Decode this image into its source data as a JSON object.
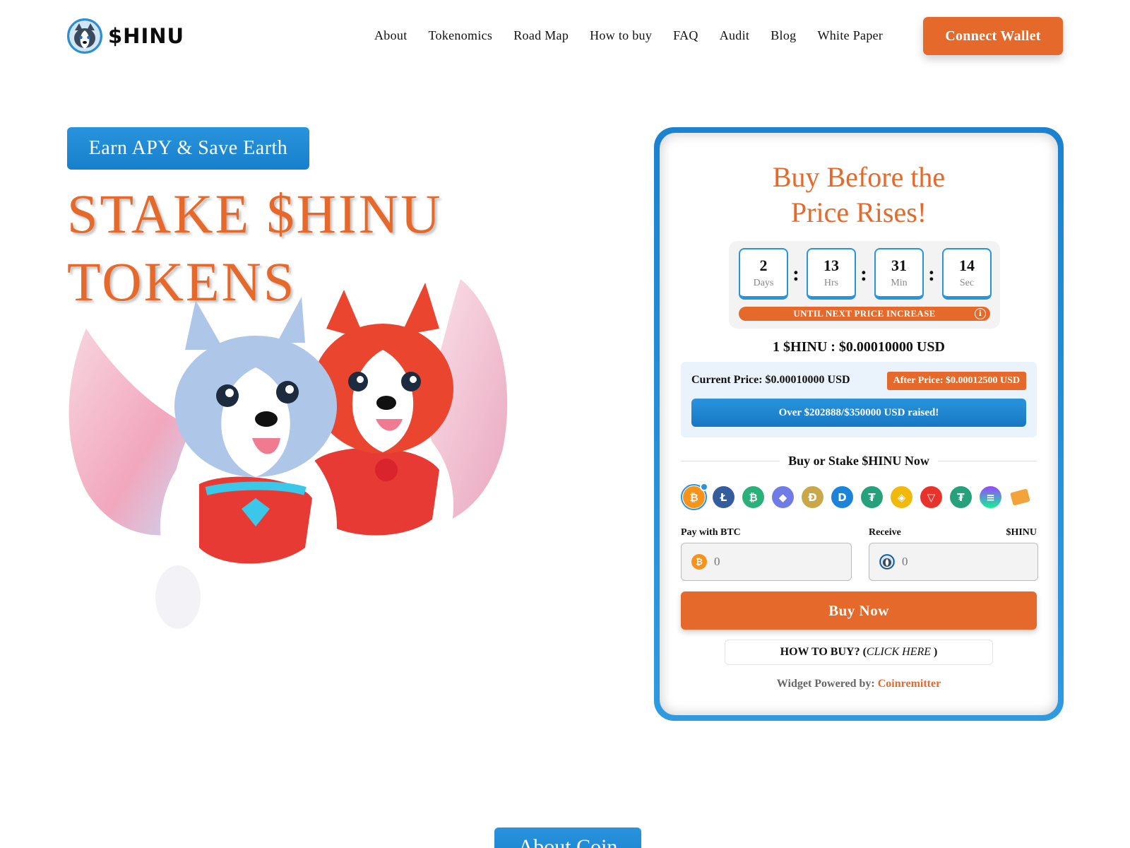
{
  "brand": {
    "name": "$HINU"
  },
  "nav": {
    "items": [
      "About",
      "Tokenomics",
      "Road Map",
      "How to buy",
      "FAQ",
      "Audit",
      "Blog",
      "White Paper"
    ],
    "connect_label": "Connect Wallet"
  },
  "hero": {
    "badge": "Earn APY & Save Earth",
    "title_line1": "STAKE $HINU",
    "title_line2": "TOKENS"
  },
  "widget": {
    "title_line1": "Buy Before the",
    "title_line2": "Price Rises!",
    "timer": [
      {
        "value": "2",
        "label": "Days"
      },
      {
        "value": "13",
        "label": "Hrs"
      },
      {
        "value": "31",
        "label": "Min"
      },
      {
        "value": "14",
        "label": "Sec"
      }
    ],
    "timer_caption": "UNTIL NEXT PRICE INCREASE",
    "rate": "1 $HINU : $0.00010000 USD",
    "current_price": "Current Price: $0.00010000 USD",
    "after_price": "After Price: $0.00012500 USD",
    "raised": "Over $202888/$350000 USD raised!",
    "buy_heading": "Buy or Stake $HINU Now",
    "coins": [
      "bitcoin-icon",
      "litecoin-icon",
      "bitcoin-cash-icon",
      "ethereum-icon",
      "dogecoin-icon",
      "dash-icon",
      "tether-icon",
      "bnb-icon",
      "tron-icon",
      "tether-trc20-icon",
      "solana-icon",
      "card-icon"
    ],
    "pay_label": "Pay with BTC",
    "receive_label": "Receive",
    "receive_unit": "$HINU",
    "pay_placeholder": "0",
    "receive_placeholder": "0",
    "buy_button": "Buy Now",
    "howto_prefix": "HOW TO BUY? (",
    "howto_link": "CLICK HERE",
    "howto_suffix": " )",
    "powered_prefix": "Widget Powered by: ",
    "powered_brand": "Coinremitter"
  },
  "about": {
    "badge": "About Coin"
  },
  "colors": {
    "accent": "#e4692a",
    "blue": "#2a93dd"
  }
}
